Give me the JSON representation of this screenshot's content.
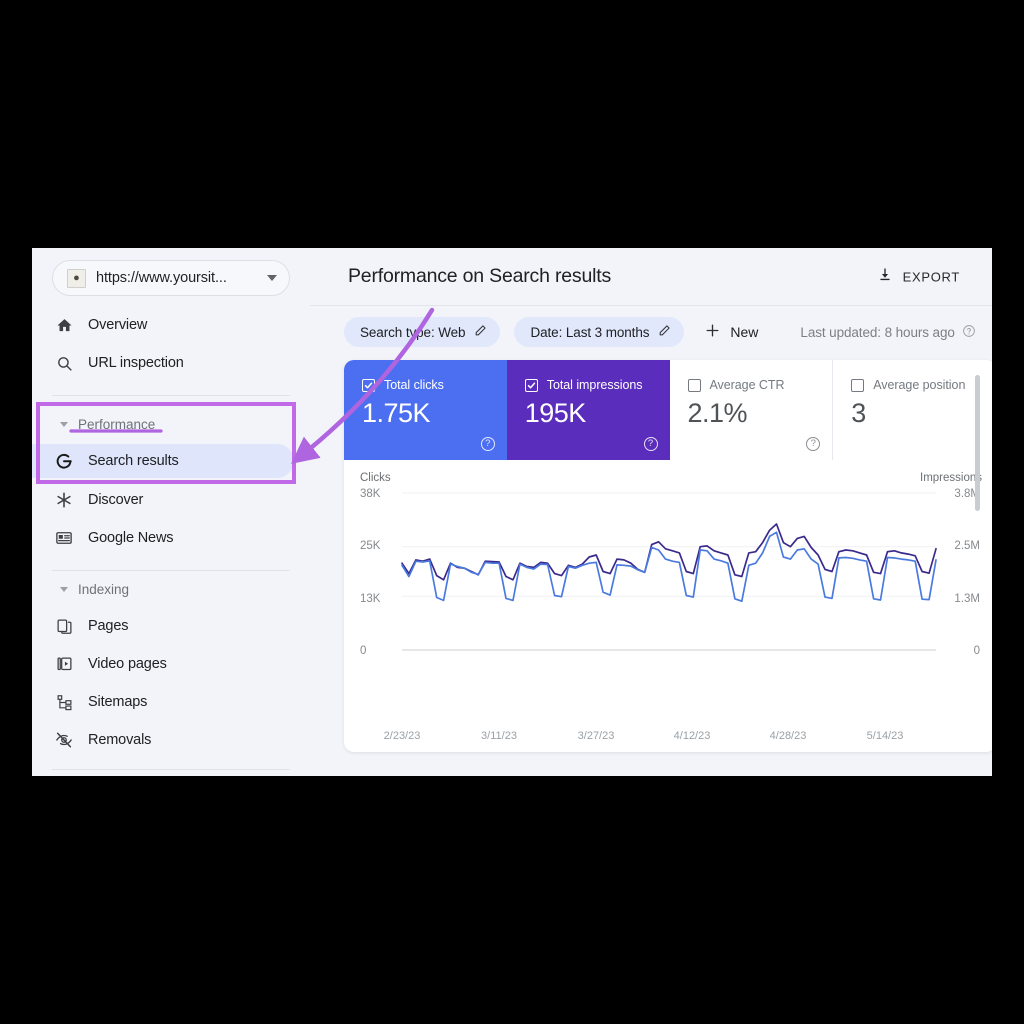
{
  "sidebar": {
    "site_picker": {
      "url": "https://www.yoursit...",
      "favicon_icon": "site-favicon-thumbnail",
      "caret_icon": "chevron-down-icon"
    },
    "items": [
      {
        "label": "Overview",
        "icon": "home-icon",
        "selected": false
      },
      {
        "label": "URL inspection",
        "icon": "search-icon",
        "selected": false
      }
    ],
    "groups": [
      {
        "label": "Performance",
        "expander_icon": "triangle-down-icon",
        "items": [
          {
            "label": "Search results",
            "icon": "google-g-icon",
            "selected": true
          },
          {
            "label": "Discover",
            "icon": "asterisk-icon",
            "selected": false
          },
          {
            "label": "Google News",
            "icon": "news-card-icon",
            "selected": false
          }
        ]
      },
      {
        "label": "Indexing",
        "expander_icon": "triangle-down-icon",
        "items": [
          {
            "label": "Pages",
            "icon": "pages-copy-icon",
            "selected": false
          },
          {
            "label": "Video pages",
            "icon": "video-page-icon",
            "selected": false
          },
          {
            "label": "Sitemaps",
            "icon": "sitemap-icon",
            "selected": false
          },
          {
            "label": "Removals",
            "icon": "eye-off-icon",
            "selected": false
          }
        ]
      }
    ]
  },
  "header": {
    "title": "Performance on Search results",
    "export_label": "EXPORT",
    "export_icon": "download-icon"
  },
  "filters": {
    "chips": [
      {
        "label": "Search type: Web",
        "edit_icon": "pencil-icon"
      },
      {
        "label": "Date: Last 3 months",
        "edit_icon": "pencil-icon"
      }
    ],
    "new_label": "New",
    "new_icon": "plus-icon",
    "last_updated": "Last updated: 8 hours ago",
    "help_icon": "question-circle-icon"
  },
  "metrics": [
    {
      "label": "Total clicks",
      "value": "1.75K",
      "checked": true,
      "help_icon": "question-circle-icon",
      "color": "#4c6ef0"
    },
    {
      "label": "Total impressions",
      "value": "195K",
      "checked": true,
      "help_icon": "question-circle-icon",
      "color": "#5b2dbd"
    },
    {
      "label": "Average CTR",
      "value": "2.1%",
      "checked": false,
      "help_icon": "question-circle-icon",
      "color": "#ffffff"
    },
    {
      "label": "Average position",
      "value": "3",
      "checked": false,
      "help_icon": "",
      "color": "#ffffff"
    }
  ],
  "annotations": {
    "accent_color": "#b065e0",
    "performance_underline": true,
    "search_results_box": true,
    "arrow_to_search_results": true
  },
  "chart_data": {
    "type": "line",
    "title": "",
    "grid": true,
    "legend": "none",
    "left_axis": {
      "label": "Clicks",
      "ticks": [
        "0",
        "13K",
        "25K",
        "38K"
      ],
      "ylim": [
        0,
        38000
      ]
    },
    "right_axis": {
      "label": "Impressions",
      "ticks": [
        "0",
        "1.3M",
        "2.5M",
        "3.8M"
      ],
      "ylim": [
        0,
        3800000
      ]
    },
    "x_ticks": [
      "2/23/23",
      "3/11/23",
      "3/27/23",
      "4/12/23",
      "4/28/23",
      "5/14/23"
    ],
    "xlabel": "",
    "series": [
      {
        "name": "Impressions",
        "color": "#3b2a8c",
        "axis": "right",
        "values": [
          2100000,
          1850000,
          2180000,
          2150000,
          2200000,
          1800000,
          1700000,
          2100000,
          2000000,
          1980000,
          1900000,
          1820000,
          2150000,
          2140000,
          2130000,
          1780000,
          1700000,
          2100000,
          2020000,
          2000000,
          2120000,
          2100000,
          1850000,
          1800000,
          2050000,
          2000000,
          2080000,
          2250000,
          2300000,
          1900000,
          1850000,
          2200000,
          2180000,
          2100000,
          1950000,
          1880000,
          2550000,
          2620000,
          2450000,
          2400000,
          2350000,
          1900000,
          1850000,
          2500000,
          2520000,
          2400000,
          2350000,
          2300000,
          1820000,
          1780000,
          2350000,
          2380000,
          2600000,
          2900000,
          3050000,
          2600000,
          2500000,
          2700000,
          2750000,
          2480000,
          2300000,
          1950000,
          1900000,
          2380000,
          2420000,
          2400000,
          2350000,
          2300000,
          1880000,
          1850000,
          2380000,
          2400000,
          2350000,
          2320000,
          2280000,
          1900000,
          1860000,
          2450000
        ]
      },
      {
        "name": "Clicks",
        "color": "#4a7ae0",
        "axis": "left",
        "values": [
          20500,
          17800,
          21500,
          21300,
          21600,
          12700,
          12000,
          20800,
          20200,
          19800,
          18800,
          18300,
          21200,
          21000,
          21000,
          12500,
          12000,
          20800,
          20000,
          19600,
          20800,
          20700,
          13200,
          12900,
          20200,
          19800,
          20500,
          21000,
          21200,
          14000,
          13300,
          20600,
          20500,
          20300,
          19400,
          18800,
          24800,
          24200,
          22000,
          21500,
          21200,
          13200,
          12800,
          24200,
          24000,
          22000,
          21600,
          21000,
          12400,
          11800,
          20500,
          21000,
          23500,
          27500,
          28500,
          22500,
          22000,
          24200,
          24500,
          22000,
          20800,
          12800,
          12500,
          22300,
          22400,
          22200,
          21800,
          21500,
          12400,
          12100,
          22400,
          22300,
          22000,
          21800,
          21500,
          12300,
          12200,
          21800
        ]
      }
    ]
  }
}
